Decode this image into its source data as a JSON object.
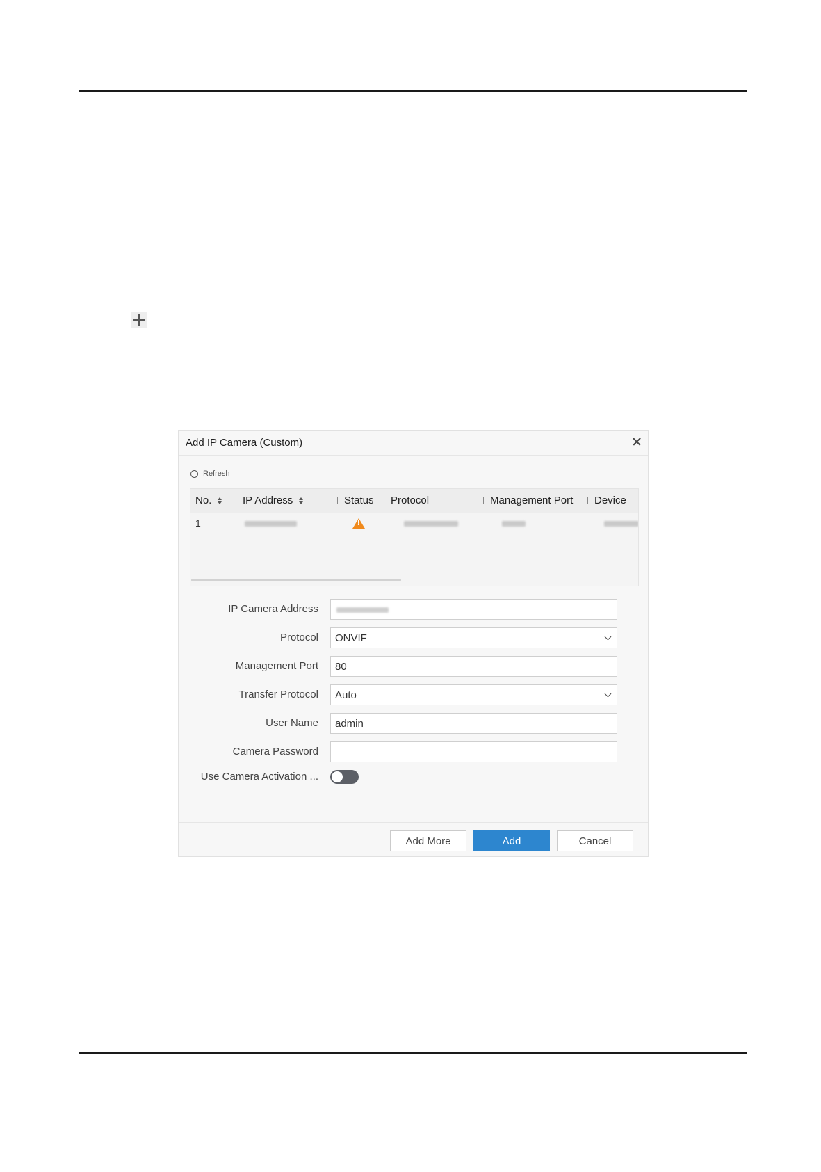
{
  "dialog": {
    "title": "Add IP Camera (Custom)",
    "refresh_label": "Refresh",
    "table": {
      "columns": [
        "No.",
        "IP Address",
        "Status",
        "Protocol",
        "Management Port",
        "Device"
      ],
      "rows": [
        {
          "no": "1",
          "status": "warning"
        }
      ]
    },
    "form": {
      "ip_address_label": "IP Camera Address",
      "protocol_label": "Protocol",
      "protocol_value": "ONVIF",
      "management_port_label": "Management Port",
      "management_port_value": "80",
      "transfer_protocol_label": "Transfer Protocol",
      "transfer_protocol_value": "Auto",
      "user_name_label": "User Name",
      "user_name_value": "admin",
      "password_label": "Camera Password",
      "password_value": "",
      "activation_label": "Use Camera Activation ...",
      "activation_enabled": false
    },
    "buttons": {
      "add_more": "Add More",
      "add": "Add",
      "cancel": "Cancel"
    }
  },
  "colors": {
    "primary": "#2d86cf",
    "warning": "#f08a1c",
    "toggle_off": "#5c5f66"
  },
  "icons": [
    "plus-icon",
    "close-icon",
    "refresh-icon",
    "sort-icon",
    "warning-icon",
    "chevron-down-icon"
  ]
}
